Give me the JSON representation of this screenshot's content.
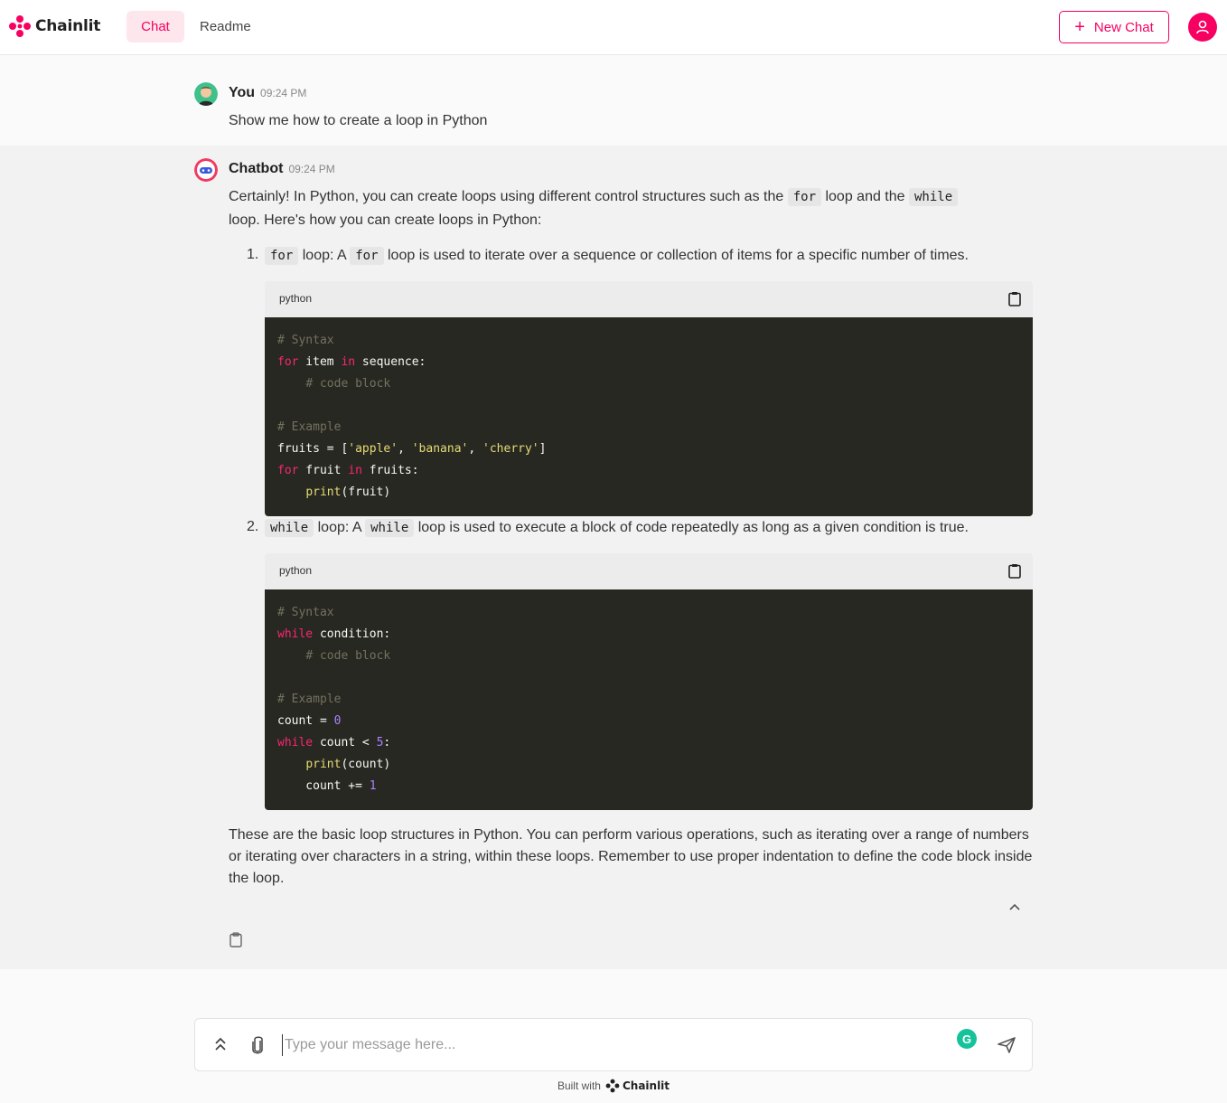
{
  "header": {
    "brand": "Chainlit",
    "tabs": [
      {
        "label": "Chat",
        "active": true
      },
      {
        "label": "Readme",
        "active": false
      }
    ],
    "new_chat_label": "New Chat",
    "accent_color": "#f80061"
  },
  "user_message": {
    "author": "You",
    "time": "09:24 PM",
    "text": "Show me how to create a loop in Python"
  },
  "bot_message": {
    "author": "Chatbot",
    "time": "09:24 PM",
    "intro_1": "Certainly! In Python, you can create loops using different control structures such as the",
    "intro_for": "for",
    "intro_2": "loop and the",
    "intro_while": "while",
    "intro_3": "loop. Here's how you can create loops in Python:",
    "items": [
      {
        "num": "1.",
        "kw": "for",
        "mid": "loop: A",
        "kw2": "for",
        "rest": "loop is used to iterate over a sequence or collection of items for a specific number of times.",
        "lang": "python"
      },
      {
        "num": "2.",
        "kw": "while",
        "mid": "loop: A",
        "kw2": "while",
        "rest": "loop is used to execute a block of code repeatedly as long as a given condition is true.",
        "lang": "python"
      }
    ],
    "outro": "These are the basic loop structures in Python. You can perform various operations, such as iterating over a range of numbers or iterating over characters in a string, within these loops. Remember to use proper indentation to define the code block inside the loop."
  },
  "input": {
    "placeholder": "Type your message here..."
  },
  "footer": {
    "built_with": "Built with",
    "brand": "Chainlit"
  }
}
